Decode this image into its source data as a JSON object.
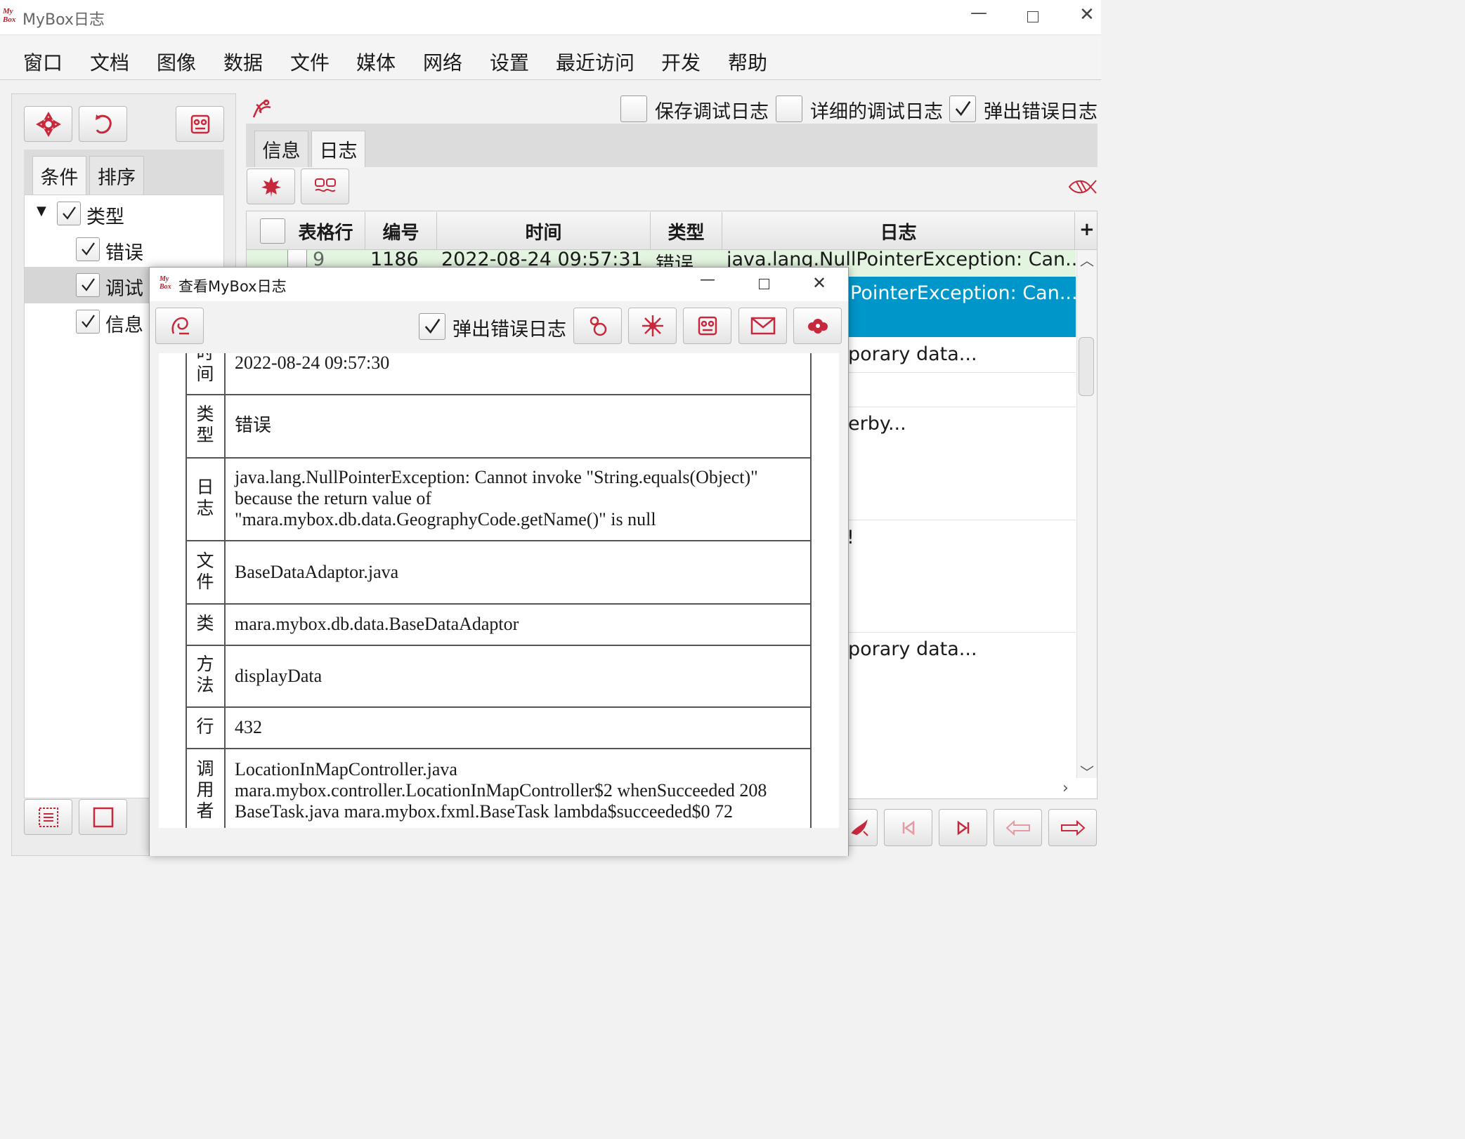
{
  "titlebar": {
    "logo_top": "My",
    "logo_bottom": "Box",
    "title": "MyBox日志"
  },
  "menu": [
    "窗口",
    "文档",
    "图像",
    "数据",
    "文件",
    "媒体",
    "网络",
    "设置",
    "最近访问",
    "开发",
    "帮助"
  ],
  "left_panel": {
    "tabs": [
      "条件",
      "排序"
    ],
    "tree": {
      "root": "类型",
      "children": [
        "错误",
        "调试",
        "信息"
      ]
    }
  },
  "right_panel": {
    "options": {
      "save_debug": "保存调试日志",
      "detailed_debug": "详细的调试日志",
      "popup_error": "弹出错误日志"
    },
    "tabs": [
      "信息",
      "日志"
    ],
    "table": {
      "columns": [
        "表格行",
        "编号",
        "时间",
        "类型",
        "日志"
      ],
      "first_row": {
        "row": "9",
        "id": "1186",
        "time": "2022-08-24 09:57:31",
        "type": "错误",
        "log": "java.lang.NullPointerException: Can..."
      },
      "visible_fragments": [
        "PointerException: Can...",
        "porary data...",
        "erby...",
        "!",
        "porary data..."
      ]
    }
  },
  "dialog": {
    "logo_top": "My",
    "logo_bottom": "Box",
    "title": "查看MyBox日志",
    "popup_error_label": "弹出错误日志",
    "rows": [
      {
        "label": "时\n间",
        "value": "2022-08-24 09:57:30"
      },
      {
        "label": "类\n型",
        "value": "错误"
      },
      {
        "label": "日\n志",
        "value": "java.lang.NullPointerException: Cannot invoke \"String.equals(Object)\"\nbecause the return value of\n\"mara.mybox.db.data.GeographyCode.getName()\" is null"
      },
      {
        "label": "文\n件",
        "value": "BaseDataAdaptor.java"
      },
      {
        "label": "类",
        "value": "mara.mybox.db.data.BaseDataAdaptor"
      },
      {
        "label": "方\n法",
        "value": "displayData"
      },
      {
        "label": "行",
        "value": "432"
      },
      {
        "label": "调\n用\n者",
        "value": "LocationInMapController.java\nmara.mybox.controller.LocationInMapController$2 whenSucceeded 208\nBaseTask.java mara.mybox.fxml.BaseTask lambda$succeeded$0 72"
      }
    ]
  },
  "colors": {
    "accent_red": "#c8283c",
    "selection_blue": "#0096c9",
    "row_green": "#e3f5e0"
  }
}
